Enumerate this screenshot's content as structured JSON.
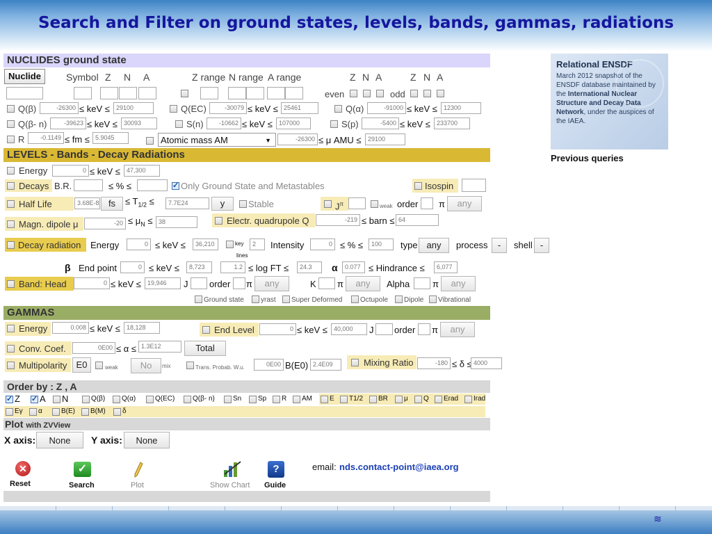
{
  "title": "Search and Filter on ground states, levels, bands, gammas, radiations",
  "nuclides": {
    "header": "NUCLIDES ground state",
    "tab": "Nuclide",
    "symbol": "Symbol",
    "z": "Z",
    "n": "N",
    "a": "A",
    "zrange": "Z range",
    "nrange": "N range",
    "arange": "A range",
    "even": "even",
    "odd": "odd",
    "qbeta": "Q(β)",
    "qbeta_min": "-26300",
    "qbeta_max": "29100",
    "unit_kev": "≤ keV ≤",
    "qec": "Q(EC)",
    "qec_min": "-30079",
    "qec_max": "25461",
    "qalpha": "Q(α)",
    "qalpha_min": "-91000",
    "qalpha_max": "12300",
    "qbn": "Q(β- n)",
    "qbn_min": "-39623",
    "qbn_max": "30093",
    "sn": "S(n)",
    "sn_min": "-10662",
    "sn_max": "107000",
    "sp": "S(p)",
    "sp_min": "-5400",
    "sp_max": "233700",
    "r": "R",
    "r_min": "-0.1149",
    "r_max": "5.9045",
    "unit_fm": "≤ fm ≤",
    "mass_select": "Atomic mass AM",
    "mass_min": "-26300",
    "mass_max": "29100",
    "unit_amu": "≤ μ AMU ≤"
  },
  "levels": {
    "header": "LEVELS - Bands - Decay Radiations",
    "energy": "Energy",
    "energy_min": "0",
    "energy_max": "47,300",
    "unit_kev": "≤ keV ≤",
    "decays": "Decays",
    "br": "B.R.",
    "unit_pct": "≤ % ≤",
    "only_gs": "Only Ground State and Metastables",
    "isospin": "Isospin",
    "halflife": "Half Life",
    "hl_min": "3.68E-8",
    "hl_unit": "fs",
    "t12": "≤ T",
    "t12_sub": "1/2",
    "le": "≤",
    "hl_max": "7.7E24",
    "hl_max_unit": "y",
    "stable": "Stable",
    "jpi": "J",
    "jpi_sup": "π",
    "weak": "weak",
    "order": "order",
    "pi": "π",
    "any": "any",
    "magdip": "Magn. dipole μ",
    "magdip_min": "-20",
    "mun": "≤ μ",
    "mun_sub": "N",
    "mun_le": "≤",
    "magdip_max": "38",
    "quad": "Electr. quadrupole Q",
    "quad_min": "-219",
    "unit_barn": "≤ barn ≤",
    "quad_max": "64",
    "decayrad": "Decay radiation",
    "dr_energy": "Energy",
    "dr_en_min": "0",
    "dr_en_max": "36,210",
    "key": "key",
    "lines": "lines",
    "key_val": "2",
    "intensity": "Intensity",
    "int_min": "0",
    "int_max": "100",
    "type": "type",
    "type_val": "any",
    "process": "process",
    "process_val": "-",
    "shell": "shell",
    "shell_val": "-",
    "beta": "β",
    "endpoint": "End point",
    "ep_min": "0",
    "ep_max": "8,723",
    "logft_min": "1.2",
    "logft": "≤ log FT ≤",
    "logft_max": "24.3",
    "alpha": "α",
    "hind_min": "0.077",
    "hind": "≤ Hindrance ≤",
    "hind_max": "6,077",
    "bandhead": "Band: Head",
    "bh_min": "0",
    "bh_max": "19,946",
    "j": "J",
    "k": "K",
    "alpha_lbl": "Alpha",
    "bandtypes": [
      "Ground state",
      "yrast",
      "Super Deformed",
      "Octupole",
      "Dipole",
      "Vibrational"
    ]
  },
  "gammas": {
    "header": "GAMMAS",
    "energy": "Energy",
    "en_min": "0.008",
    "en_max": "18,128",
    "unit_kev": "≤ keV ≤",
    "endlevel": "End Level",
    "el_min": "0",
    "el_max": "40,000",
    "j": "J",
    "order": "order",
    "pi": "π",
    "any": "any",
    "convcoef": "Conv. Coef.",
    "cc_min": "0E00",
    "cc_le": "≤ α ≤",
    "cc_max": "1.3E12",
    "total": "Total",
    "multipol": "Multipolarity",
    "mp_val": "E0",
    "weak": "weak",
    "no": "No",
    "mix": "mix",
    "tp": "Trans. Probab. W.u.",
    "tp_min": "0E00",
    "be0": "B(E0)",
    "be0_max": "2.4E09",
    "mixing": "Mixing Ratio",
    "mr_min": "-180",
    "mr_le": "≤ δ ≤",
    "mr_max": "4000"
  },
  "order": {
    "header": "Order by : Z , A",
    "row1": [
      "Z",
      "A",
      "N",
      "Q(β)",
      "Q(α)",
      "Q(EC)",
      "Q(β- n)",
      "Sn",
      "Sp",
      "R",
      "AM",
      "E",
      "T1/2",
      "BR",
      "μ",
      "Q",
      "Erad",
      "Irad"
    ],
    "row2": [
      "Eγ",
      "α",
      "B(E)",
      "B(M)",
      "δ"
    ]
  },
  "plot": {
    "header": "Plot",
    "with": "with ZVView",
    "xaxis": "X axis:",
    "xval": "None",
    "yaxis": "Y axis:",
    "yval": "None"
  },
  "actions": {
    "reset": "Reset",
    "search": "Search",
    "plot": "Plot",
    "showchart": "Show Chart",
    "guide": "Guide",
    "email_label": "email:",
    "email": "nds.contact-point@iaea.org"
  },
  "sidebar": {
    "title": "Relational ENSDF",
    "text1": "March 2012 snapshot of the ENSDF database maintained by the ",
    "bold1": "International Nuclear Structure and Decay Data Network",
    "text2": ", under the auspices of the IAEA.",
    "prev": "Previous queries"
  },
  "colors": {
    "nuclides_header": "#d9d5fb",
    "levels_header": "#d9b834",
    "gammas_header": "#9aad65",
    "order_header": "#d8d8d8",
    "highlight": "#f7ebb6"
  }
}
